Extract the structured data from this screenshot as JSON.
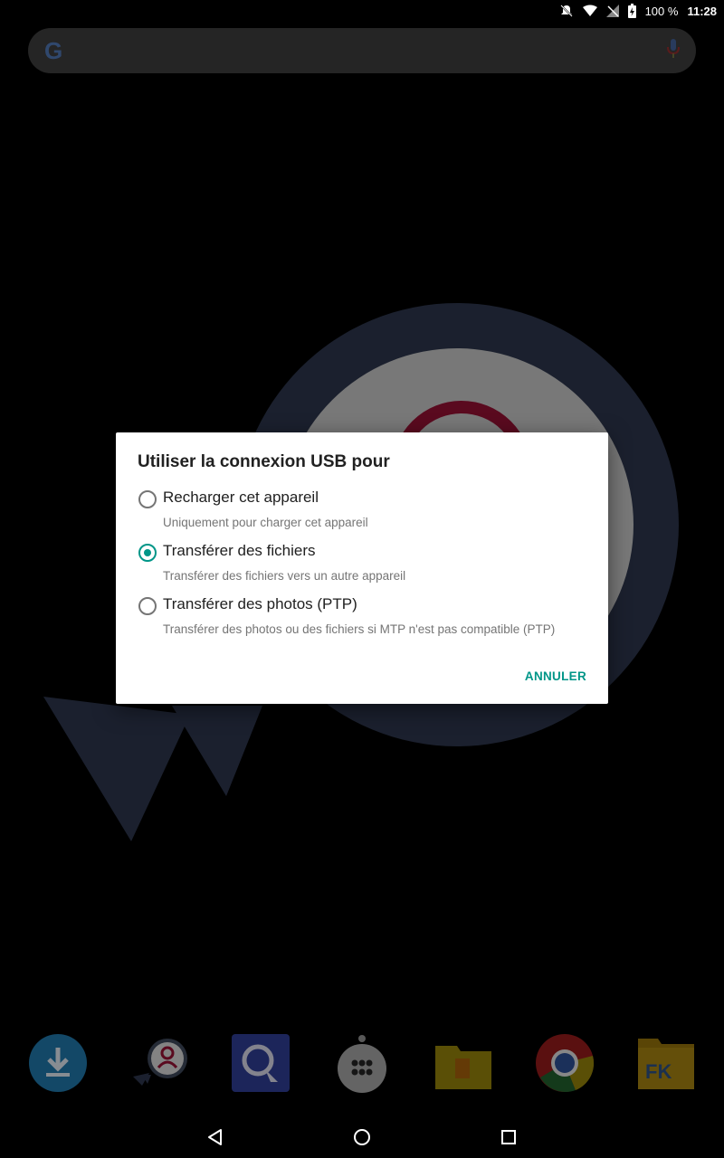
{
  "status_bar": {
    "battery_percent": "100 %",
    "time": "11:28",
    "icons": [
      "notifications-off-icon",
      "wifi-icon",
      "signal-off-icon",
      "battery-charging-icon"
    ]
  },
  "search_bar": {
    "logo": "G",
    "icons": [
      "google-logo",
      "mic-icon"
    ]
  },
  "dialog": {
    "title": "Utiliser la connexion USB pour",
    "options": [
      {
        "label": "Recharger cet appareil",
        "description": "Uniquement pour charger cet appareil",
        "selected": false
      },
      {
        "label": "Transférer des fichiers",
        "description": "Transférer des fichiers vers un autre appareil",
        "selected": true
      },
      {
        "label": "Transférer des photos (PTP)",
        "description": "Transférer des photos ou des fichiers si MTP n'est pas compatible (PTP)",
        "selected": false
      }
    ],
    "cancel_label": "ANNULER",
    "accent_color": "#009688"
  },
  "dock": {
    "apps": [
      "download-app-icon",
      "contacts-app-icon",
      "quickoffice-app-icon",
      "app-drawer-icon",
      "files-app-icon",
      "chrome-app-icon",
      "file-commander-app-icon"
    ]
  },
  "nav_bar": {
    "buttons": [
      "back-icon",
      "home-icon",
      "recents-icon"
    ]
  }
}
